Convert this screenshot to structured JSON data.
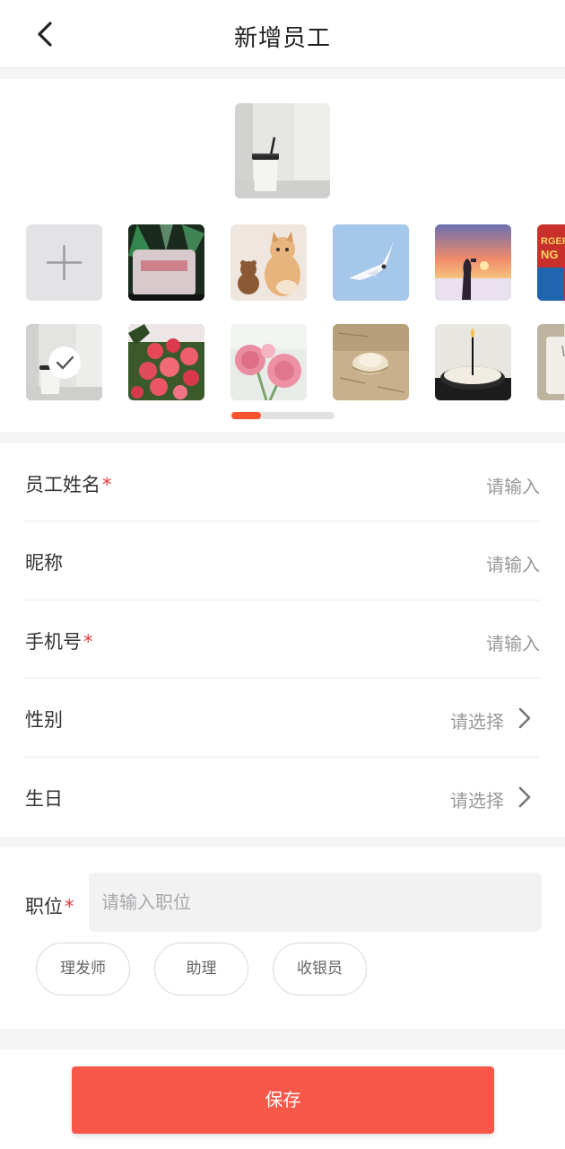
{
  "header": {
    "title": "新增员工",
    "back_icon": "chevron-left-icon"
  },
  "avatar_picker": {
    "add_icon": "plus-icon",
    "selected_index": 5,
    "selected_icon": "check-icon",
    "scroll_position": 0.3
  },
  "form": {
    "rows": [
      {
        "label": "员工姓名",
        "required": "*",
        "placeholder": "请输入"
      },
      {
        "label": "昵称",
        "required": "",
        "placeholder": "请输入"
      },
      {
        "label": "手机号",
        "required": "*",
        "placeholder": "请输入"
      },
      {
        "label": "性别",
        "required": "",
        "placeholder": "请选择",
        "icon": "chevron-right-icon"
      },
      {
        "label": "生日",
        "required": "",
        "placeholder": "请选择",
        "icon": "chevron-right-icon"
      }
    ]
  },
  "position": {
    "label": "职位",
    "required": "*",
    "placeholder": "请输入职位",
    "chips": [
      "理发师",
      "助理",
      "收银员"
    ]
  },
  "footer": {
    "save_label": "保存"
  },
  "colors": {
    "accent": "#f7532f",
    "save_button": "#f7584a",
    "required_mark": "#e23a3a"
  }
}
